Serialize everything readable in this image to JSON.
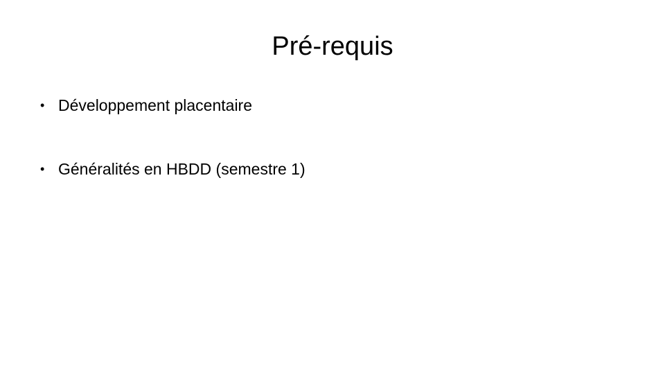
{
  "slide": {
    "title": "Pré-requis",
    "bullet_symbol": "•",
    "bullets": [
      {
        "text": "Développement placentaire"
      },
      {
        "text": "Généralités en HBDD (semestre 1)"
      }
    ]
  }
}
